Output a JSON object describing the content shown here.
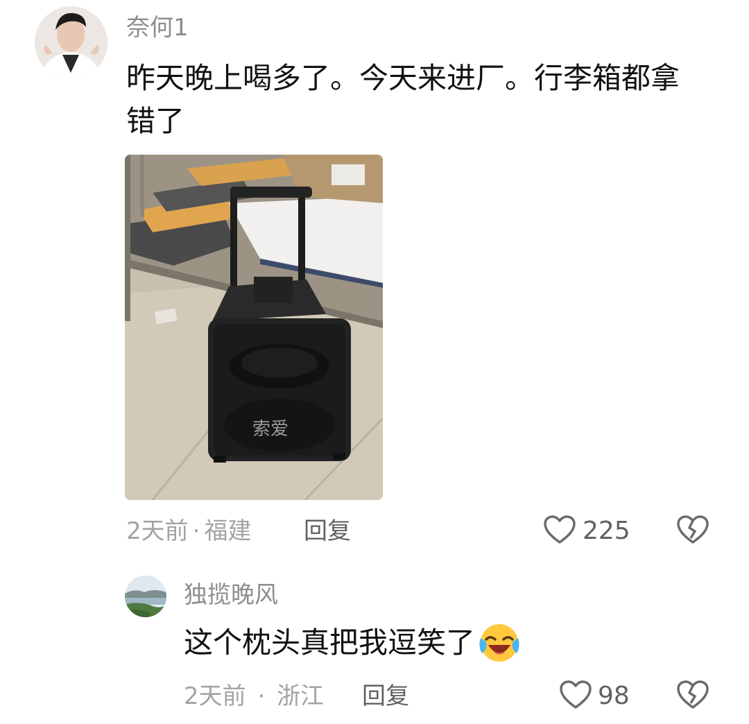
{
  "comments": [
    {
      "username": "奈何1",
      "text": "昨天晚上喝多了。今天来进厂。行李箱都拿错了",
      "photo_brand_text": "索爱",
      "time": "2天前",
      "separator": "·",
      "location": "福建",
      "reply_label": "回复",
      "like_count": "225"
    },
    {
      "username": "独揽晚风",
      "text": "这个枕头真把我逗笑了",
      "time": "2天前",
      "separator": "·",
      "location": "浙江",
      "reply_label": "回复",
      "like_count": "98"
    }
  ],
  "icons": {
    "like": "heart-outline-icon",
    "dislike": "broken-heart-icon",
    "emoji": "laughing-crying-emoji-icon"
  },
  "colors": {
    "username": "#8d8d8d",
    "meta": "#a3a3a3",
    "action": "#616161",
    "text": "#111111"
  }
}
